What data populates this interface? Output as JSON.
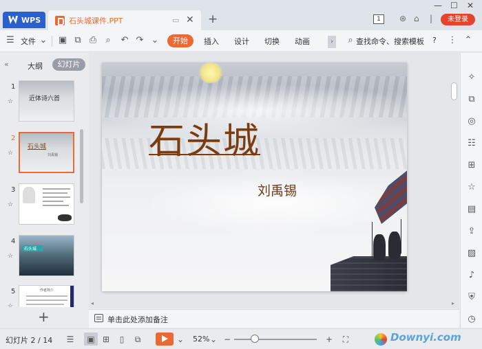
{
  "titlebar": {
    "app_tab": "WPS",
    "doc_title": "石头城课件.PPT",
    "page_badge": "1",
    "login": "未登录"
  },
  "ribbon": {
    "file": "文件",
    "tabs": [
      "开始",
      "插入",
      "设计",
      "切换",
      "动画"
    ],
    "search": "查找命令、搜索模板",
    "help": "?"
  },
  "left_panel": {
    "tab_outline": "大纲",
    "tab_slides": "幻灯片",
    "thumbnails": [
      {
        "num": "1",
        "text": "近体诗六首"
      },
      {
        "num": "2",
        "text": "石头城",
        "sub": "刘禹锡"
      },
      {
        "num": "3",
        "text": ""
      },
      {
        "num": "4",
        "text": "石头城"
      },
      {
        "num": "5",
        "text": "作者简介"
      }
    ]
  },
  "slide": {
    "title": "石头城",
    "author": "刘禹锡"
  },
  "notes": {
    "placeholder": "单击此处添加备注"
  },
  "status": {
    "slide_counter": "幻灯片 2 / 14",
    "zoom": "52%",
    "watermark": "Downyi.com"
  },
  "colors": {
    "accent": "#e96b33",
    "wps_blue": "#2b5fc9",
    "login_red": "#e8412d",
    "title_brown": "#7a3c10"
  }
}
